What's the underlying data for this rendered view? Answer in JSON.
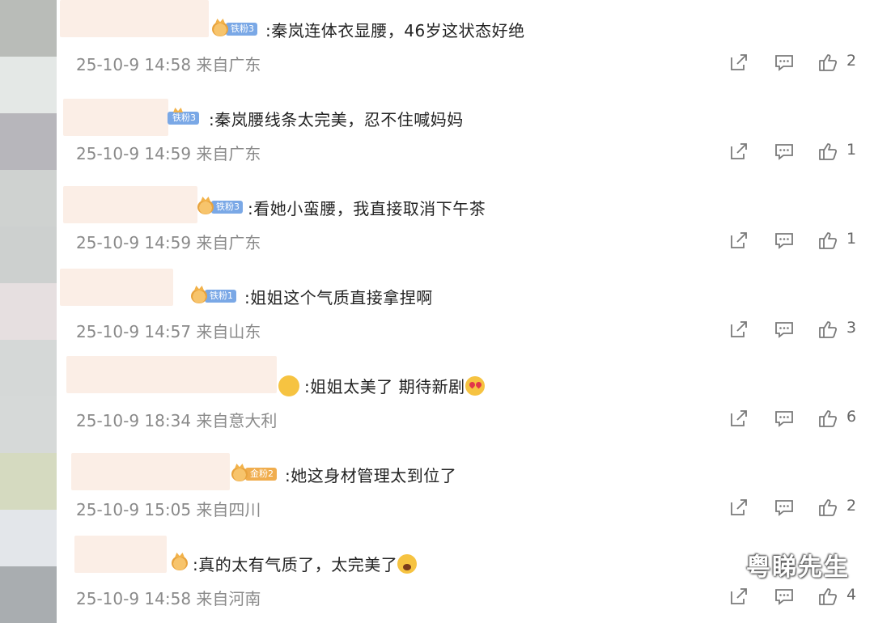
{
  "colors": {
    "text": "#222222",
    "meta": "#8a8a8a",
    "badge_blue": "#7aa8e6",
    "badge_gold": "#f0ad4e",
    "name_blur": "#fbeee6",
    "icon": "#7a7a7a"
  },
  "comments": [
    {
      "badge": "铁粉3",
      "badge_style": "blue",
      "text": ":秦岚连体衣显腰，46岁这状态好绝",
      "time": "25-10-9 14:58",
      "location": "来自广东",
      "likes": "2"
    },
    {
      "badge": "铁粉3",
      "badge_style": "blue",
      "text": ":秦岚腰线条太完美，忍不住喊妈妈",
      "time": "25-10-9 14:59",
      "location": "来自广东",
      "likes": "1"
    },
    {
      "badge": "铁粉3",
      "badge_style": "blue",
      "text": ":看她小蛮腰，我直接取消下午茶",
      "time": "25-10-9 14:59",
      "location": "来自广东",
      "likes": "1"
    },
    {
      "badge": "铁粉1",
      "badge_style": "blue",
      "text": ":姐姐这个气质直接拿捏啊",
      "time": "25-10-9 14:57",
      "location": "来自山东",
      "likes": "3"
    },
    {
      "badge": "",
      "badge_style": "none",
      "text": ":姐姐太美了 期待新剧",
      "text_emoji": "heart-eyes-emoji",
      "time": "25-10-9 18:34",
      "location": "来自意大利",
      "likes": "6"
    },
    {
      "badge": "金粉2",
      "badge_style": "gold",
      "text": ":她这身材管理太到位了",
      "time": "25-10-9 15:05",
      "location": "来自四川",
      "likes": "2"
    },
    {
      "badge": "",
      "badge_style": "crown-only",
      "text": ":真的太有气质了，太完美了",
      "text_emoji": "shouting-emoji",
      "time": "25-10-9 14:58",
      "location": "来自河南",
      "likes": "4"
    }
  ],
  "action_icons": [
    "share-icon",
    "comment-icon",
    "like-icon"
  ],
  "watermark": "粤睇先生"
}
